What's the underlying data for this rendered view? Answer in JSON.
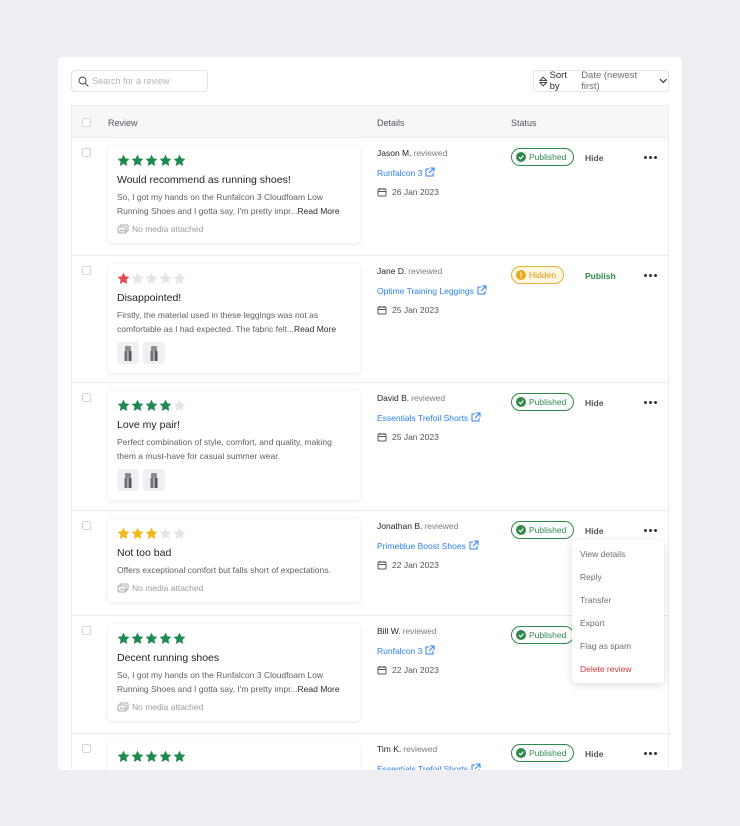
{
  "search": {
    "placeholder": "Search for a review"
  },
  "sort": {
    "label": "Sort by",
    "value": "Date (newest first)"
  },
  "table": {
    "headers": {
      "review": "Review",
      "details": "Details",
      "status": "Status"
    }
  },
  "reviewed_word": "reviewed",
  "colors": {
    "star_green": "#1e8a50",
    "star_red": "#e5484d",
    "star_yellow": "#f2b619",
    "star_empty": "#e4e4ea",
    "published": "#2e8a4a",
    "hidden": "#e8b13a",
    "link": "#2f80ed",
    "danger": "#d63a3a"
  },
  "reviews": [
    {
      "rating": 5,
      "title": "Would recommend as running shoes!",
      "body": "So, I got my hands on the Runfalcon 3 Cloudfoam Low Running Shoes and I gotta say, I'm pretty impr...",
      "read_more": "Read More",
      "media_text": "No media attached",
      "reviewer": "Jason M.",
      "product": "Runfalcon 3",
      "date": "26 Jan 2023",
      "status": "Published",
      "action": "Hide"
    },
    {
      "rating": 1,
      "title": "Disappointed!",
      "body": "Firstly, the material used in these leggings was not as comfortable as I had expected. The fabric felt...",
      "read_more": "Read More",
      "images": [
        "legging-photo-1",
        "legging-photo-2"
      ],
      "reviewer": "Jane D.",
      "product": "Optime Training Leggings",
      "date": "25 Jan 2023",
      "status": "Hidden",
      "action": "Publish"
    },
    {
      "rating": 4,
      "title": "Love my pair!",
      "body": "Perfect combination of style, comfort, and quality, making them a must-have for casual summer wear.",
      "images": [
        "shorts-photo-1",
        "shorts-photo-2"
      ],
      "reviewer": "David B.",
      "product": "Essentials Trefoil Shorts",
      "date": "25 Jan 2023",
      "status": "Published",
      "action": "Hide"
    },
    {
      "rating": 3,
      "title": "Not too bad",
      "body": "Offers exceptional comfort but falls short of expectations.",
      "media_text": "No media attached",
      "reviewer": "Jonathan B.",
      "product": "Primeblue Boost Shoes",
      "date": "22 Jan 2023",
      "status": "Published",
      "action": "Hide"
    },
    {
      "rating": 5,
      "title": "Decent running shoes",
      "body": "So, I got my hands on the Runfalcon 3 Cloudfoam Low Running Shoes and I gotta say, I'm pretty impr...",
      "read_more": "Read More",
      "media_text": "No media attached",
      "reviewer": "Bill W.",
      "product": "Runfalcon 3",
      "date": "22 Jan 2023",
      "status": "Published",
      "action": ""
    },
    {
      "rating": 5,
      "title": "",
      "body": "",
      "reviewer": "Tim K.",
      "product": "Essentials Trefoil Shorts",
      "date": "",
      "status": "Published",
      "action": "Hide"
    }
  ],
  "context_menu": {
    "items": [
      "View details",
      "Reply",
      "Transfer",
      "Export",
      "Flag as spam"
    ],
    "danger_item": "Delete review"
  }
}
